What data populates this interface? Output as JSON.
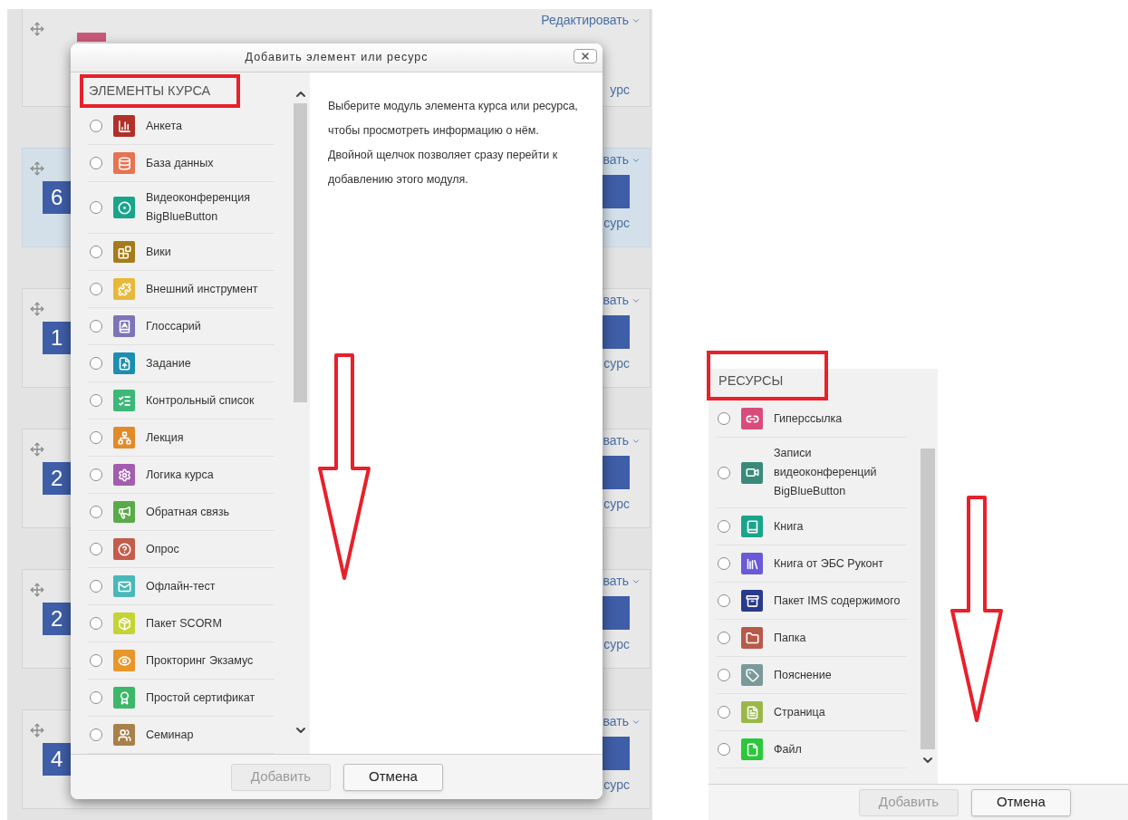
{
  "course_sections": [
    {
      "highlighted": false,
      "edit_label": "Редактировать",
      "resource_label": "урс"
    },
    {
      "number": "6",
      "highlighted": true,
      "edit_label": "вать",
      "resource_label": "сурс"
    },
    {
      "number": "1",
      "highlighted": false,
      "edit_label": "вать",
      "resource_label": "сурс"
    },
    {
      "number": "2",
      "highlighted": false,
      "edit_label": "вать",
      "resource_label": "сурс"
    },
    {
      "number": "2",
      "highlighted": false,
      "edit_label": "вать",
      "resource_label": "сурс"
    },
    {
      "number": "4",
      "highlighted": false,
      "edit_label": "вать",
      "resource_label": "сурс"
    }
  ],
  "dialog": {
    "title": "Добавить элемент или ресурс",
    "section_heading": "ЭЛЕМЕНТЫ КУРСА",
    "modules": [
      {
        "label": "Анкета",
        "color": "#b0302a",
        "selected": false
      },
      {
        "label": "База данных",
        "color": "#e67352",
        "selected": false
      },
      {
        "label": "Видеоконференция BigBlueButton",
        "color": "#1aa58a",
        "selected": false
      },
      {
        "label": "Вики",
        "color": "#a67c1b",
        "selected": false
      },
      {
        "label": "Внешний инструмент",
        "color": "#e8b83a",
        "selected": false
      },
      {
        "label": "Глоссарий",
        "color": "#7d74b8",
        "selected": false
      },
      {
        "label": "Задание",
        "color": "#1c8fb0",
        "selected": false
      },
      {
        "label": "Контрольный список",
        "color": "#3cb878",
        "selected": false
      },
      {
        "label": "Лекция",
        "color": "#e08a2a",
        "selected": false
      },
      {
        "label": "Логика курса",
        "color": "#a35db0",
        "selected": false
      },
      {
        "label": "Обратная связь",
        "color": "#5aaa4a",
        "selected": false
      },
      {
        "label": "Опрос",
        "color": "#c45c4c",
        "selected": false
      },
      {
        "label": "Офлайн-тест",
        "color": "#4ab8b8",
        "selected": false
      },
      {
        "label": "Пакет SCORM",
        "color": "#c4d432",
        "selected": false
      },
      {
        "label": "Прокторинг Экзамус",
        "color": "#e8962a",
        "selected": false
      },
      {
        "label": "Простой сертификат",
        "color": "#3cb868",
        "selected": false
      },
      {
        "label": "Семинар",
        "color": "#a8804a",
        "selected": false
      }
    ],
    "description": "Выберите модуль элемента курса или ресурса, чтобы просмотреть информацию о нём. Двойной щелчок позволяет сразу перейти к добавлению этого модуля.",
    "buttons": [
      {
        "label": "Добавить",
        "disabled": true
      },
      {
        "label": "Отмена",
        "disabled": false
      }
    ]
  },
  "resources_panel": {
    "section_heading": "РЕСУРСЫ",
    "resources": [
      {
        "label": "Гиперссылка",
        "color": "#d84c7c",
        "selected": false
      },
      {
        "label": "Записи видеоконференций BigBlueButton",
        "color": "#3a8a7a",
        "selected": false
      },
      {
        "label": "Книга",
        "color": "#1aa58a",
        "selected": false
      },
      {
        "label": "Книга от ЭБС Руконт",
        "color": "#6a5ad8",
        "selected": false
      },
      {
        "label": "Пакет IMS содержимого",
        "color": "#2a3a8a",
        "selected": false
      },
      {
        "label": "Папка",
        "color": "#b85a4a",
        "selected": false
      },
      {
        "label": "Пояснение",
        "color": "#7a9a9a",
        "selected": false
      },
      {
        "label": "Страница",
        "color": "#9ab84a",
        "selected": false
      },
      {
        "label": "Файл",
        "color": "#2ac83a",
        "selected": false
      }
    ],
    "buttons": [
      {
        "label": "Добавить",
        "disabled": true
      },
      {
        "label": "Отмена",
        "disabled": false
      }
    ]
  }
}
